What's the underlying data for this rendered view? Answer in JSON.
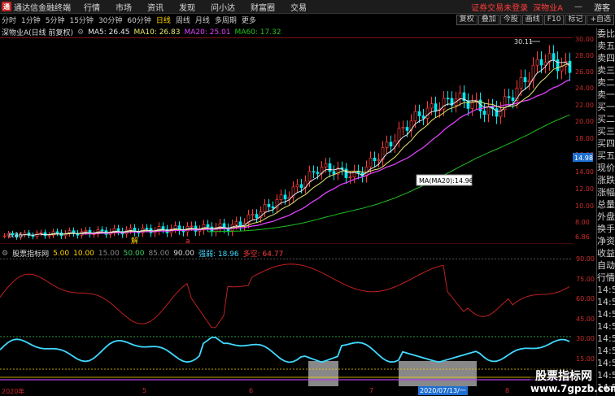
{
  "app": {
    "title": "通达信金融终端",
    "logo": "通"
  },
  "menu": [
    "行情",
    "市场",
    "资讯",
    "发现",
    "问小达",
    "财富圈",
    "交易"
  ],
  "status_text": "证券交易未登录",
  "stock_name": "深物业A",
  "guest": "游客",
  "toolbar": {
    "periods": [
      "分时",
      "1分钟",
      "5分钟",
      "15分钟",
      "30分钟",
      "60分钟",
      "日线",
      "周线",
      "月线",
      "多周期",
      "更多"
    ],
    "active": "日线",
    "buttons": [
      "复权",
      "叠加",
      "今股",
      "画线",
      "F10",
      "标记",
      "+自选"
    ]
  },
  "chart_title": "深物业A(日线 前复权)",
  "ma": {
    "ma5": "MA5: 26.45",
    "ma10": "MA10: 26.83",
    "ma20": "MA20: 25.01",
    "ma60": "MA60: 17.32"
  },
  "colors": {
    "up": "#ff3c3c",
    "down": "#00e8f0",
    "ma5": "#e8e8e8",
    "ma10": "#e8e870",
    "ma20": "#e040fb",
    "ma60": "#20c020",
    "ind_line": "#c02020",
    "ind_cyan": "#40d8ff"
  },
  "price_axis": [
    "30.00",
    "28.00",
    "26.00",
    "24.00",
    "22.00",
    "20.00",
    "18.00",
    "16.00",
    "14.00",
    "12.00",
    "10.00",
    "8.00",
    "6.86"
  ],
  "high_label": "30.11",
  "low_label": "6.86",
  "tooltip": "MA(MA20):14.96",
  "price_tag": "14.98",
  "chart_markers": [
    "解",
    "a"
  ],
  "right_panel": [
    "委比",
    "卖五",
    "卖四",
    "卖三",
    "卖二",
    "卖一",
    "买一",
    "买二",
    "买三",
    "买四",
    "买五",
    "现价",
    "涨跌",
    "涨幅",
    "总量",
    "外盘",
    "换手",
    "净资",
    "收益",
    "自动",
    "行情",
    "14:5",
    "14:5",
    "14:5",
    "14:5",
    "14:5",
    "14:5",
    "14:5",
    "14:5",
    "14:5"
  ],
  "indicator": {
    "name": "股票指标网",
    "values": [
      "5.00",
      "10.00",
      "15.00",
      "50.00",
      "85.00",
      "90.00"
    ],
    "line1": "强弱: 18.96",
    "line2": "多空: 64.77",
    "axis": [
      "90.00",
      "75.00",
      "60.00",
      "45.00",
      "30.00",
      "15.00"
    ]
  },
  "dates": [
    "2020年",
    "5",
    "6",
    "7",
    "2020/07/13/一",
    "8"
  ],
  "watermark": {
    "line1": "股票指标网",
    "line2": "www.7gpzb.com"
  }
}
